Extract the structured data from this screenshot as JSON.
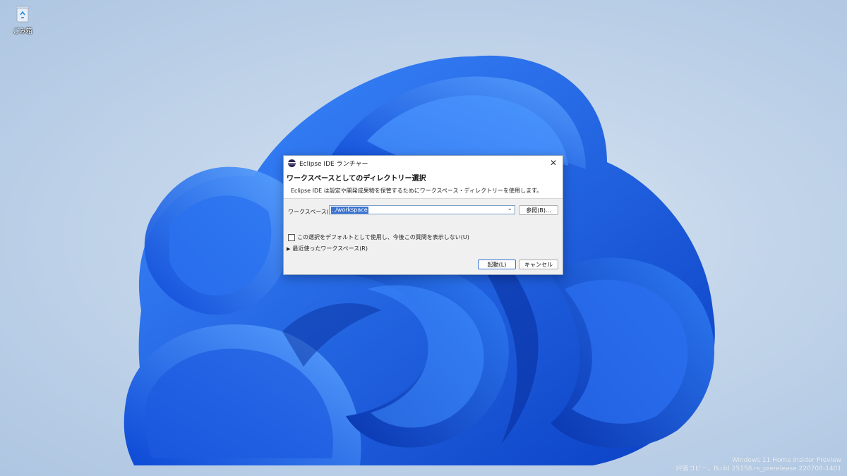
{
  "desktop": {
    "recycle_bin_label": "ごみ箱",
    "watermark_line1": "Windows 11 Home Insider Preview",
    "watermark_line2": "評価コピー。Build 25158.rs_prerelease.220708-1401"
  },
  "dialog": {
    "title": "Eclipse IDE ランチャー",
    "heading": "ワークスペースとしてのディレクトリー選択",
    "description": "Eclipse IDE は設定や開発成果物を保管するためにワークスペース・ディレクトリーを使用します。",
    "workspace_label": "ワークスペース(W):",
    "workspace_value": "../workspace",
    "browse_label": "参照(B)...",
    "checkbox_label": "この選択をデフォルトとして使用し、今後この質問を表示しない(U)",
    "checkbox_checked": false,
    "recent_label": "最近使ったワークスペース(R)",
    "launch_label": "起動(L)",
    "cancel_label": "キャンセル"
  },
  "colors": {
    "accent": "#3b74d1",
    "wallpaper_blue": "#1f5fe0"
  }
}
